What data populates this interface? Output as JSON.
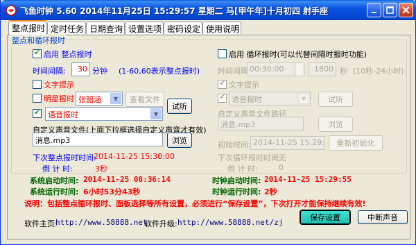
{
  "window": {
    "title": "飞鱼时钟 5.60 2014年11月25日 15:29:57 星期二 马[甲午年]十月初四 射手座",
    "controls": [
      "minimize-icon",
      "maximize-icon",
      "close-icon"
    ]
  },
  "tabs": [
    {
      "label": "整点报时",
      "active": true
    },
    {
      "label": "定时任务"
    },
    {
      "label": "日期查询"
    },
    {
      "label": "设置选项"
    },
    {
      "label": "密码设定"
    },
    {
      "label": "使用说明"
    }
  ],
  "group_title": "整点和循环报时",
  "left": {
    "enable_hourly": "启用 整点报时",
    "interval_label": "时间间隔:",
    "interval_value": "30",
    "interval_unit": "分钟",
    "interval_hint": "(1-60,60表示整点报时)",
    "text_prompt": "文字提示",
    "star_chime": "明星报时",
    "star_select": "张韶涵",
    "view_file_button": "查看文件",
    "voice_select": "语音报时",
    "listen_button": "试听",
    "custom_sound_label": "自定义声音文件(上面下拉框选择自定义声音才有效)",
    "custom_sound_value": "消息.mp3",
    "browse_button": "浏览",
    "next_label": "下次整点报时时间:",
    "next_value": "2014-11-25 15:30:00",
    "countdown_label": "倒 计 时:",
    "countdown_value": "3秒"
  },
  "right": {
    "enable_cycle": "启用 循环报时(可以代替间隔时报时功能)",
    "interval_label": "时间间隔",
    "interval_time": "00:30:00",
    "interval_seconds": "1800",
    "seconds_unit": "秒",
    "seconds_hint": "(10秒-24小时)",
    "text_prompt": "文字提示",
    "voice_select": "语音报时",
    "listen_button": "试听",
    "custom_sound_label": "自定义声音文件路径",
    "custom_sound_value": "消息.mp3",
    "browse_button": "浏览",
    "init_label": "初始时间:",
    "init_value": "2014-11-25 15:29:55",
    "reinit_button": "重新初始化",
    "next_label": "下次循环报时时间:",
    "next_value": "无",
    "countdown_label": "倒 计 时:",
    "countdown_value": "0"
  },
  "status": {
    "sys_start_label": "系统启动时间:",
    "sys_start_value": "2014-11-25 08:36:14",
    "sys_run_label": "系统运行时间:",
    "sys_run_value": "6小时53分43秒",
    "clock_start_label": "时钟启动时间:",
    "clock_start_value": "2014-11-25 15:29:55",
    "clock_run_label": "时钟运行时间:",
    "clock_run_value": "2秒"
  },
  "note": "说明：包括整点循环报时、面板选择等所有设置，必须进行“保存设置”，下次打开才能保持继续有效!",
  "footer": {
    "home_label": "软件主页:",
    "home_url": "http://www.58888.net",
    "upgrade_label": "软件升级:",
    "upgrade_url": "http://www.58888.net/zj",
    "save_button": "保存设置",
    "stop_button": "中断声音"
  },
  "colors": {
    "title_bar": "#0546d1",
    "accent_blue": "#0000ff",
    "accent_red": "#ff0000",
    "status_green": "#006400",
    "save_button": "#20c0b0"
  }
}
